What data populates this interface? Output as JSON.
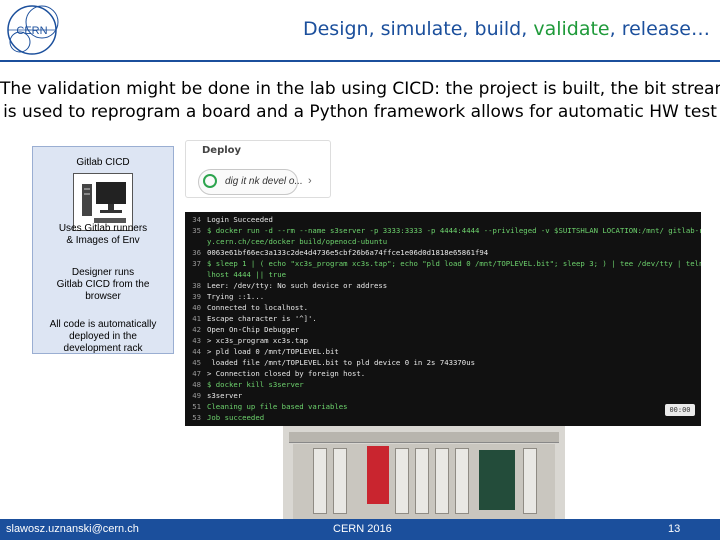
{
  "header": {
    "title_before": "Design, simulate, build, ",
    "title_highlight": "validate",
    "title_after": ", release…",
    "logo_text": "CERN"
  },
  "subtitle": {
    "line1": "The validation might be done in the lab using CICD: the project is built, the bit stream",
    "line2": "is used to reprogram a board and a Python framework allows for automatic HW test"
  },
  "info_box": {
    "heading": "Gitlab CICD",
    "runners": [
      "Uses Gitlab runners",
      "& Images of Env"
    ],
    "designer": [
      "Designer runs",
      "Gitlab CICD from the",
      "browser"
    ],
    "deployed": [
      "All code is automatically",
      "deployed in the",
      "development rack"
    ]
  },
  "deploy_card": {
    "label": "Deploy",
    "job_name": "dig it nk devel o...",
    "arrow": "›"
  },
  "terminal": {
    "lines": [
      {
        "n": "34",
        "t": "Login Succeeded",
        "green": false
      },
      {
        "n": "35",
        "t": "$ docker run -d --rm --name s3server -p 3333:3333 -p 4444:4444 --privileged -v $SUITSHLAN LOCATION:/mnt/ gitlab-registr",
        "green": true
      },
      {
        "n": "",
        "t": "y.cern.ch/cee/docker build/openocd-ubuntu",
        "green": true
      },
      {
        "n": "36",
        "t": "0063e61bf66ec3a133c2de4d4736e5cbf26b6a74ffce1e06d0d1818e65861f94",
        "green": false
      },
      {
        "n": "37",
        "t": "$ sleep 1 | ( echo \"xc3s_program xc3s.tap\"; echo \"pld load 0 /mnt/TOPLEVEL.bit\"; sleep 3; ) | tee /dev/tty | telnet loca",
        "green": true
      },
      {
        "n": "",
        "t": "lhost 4444 || true",
        "green": true
      },
      {
        "n": "38",
        "t": "Leer: /dev/tty: No such device or address",
        "green": false
      },
      {
        "n": "39",
        "t": "Trying ::1...",
        "green": false
      },
      {
        "n": "40",
        "t": "Connected to localhost.",
        "green": false
      },
      {
        "n": "41",
        "t": "Escape character is '^]'.",
        "green": false
      },
      {
        "n": "42",
        "t": "Open On-Chip Debugger",
        "green": false
      },
      {
        "n": "43",
        "t": "> xc3s_program xc3s.tap",
        "green": false
      },
      {
        "n": "44",
        "t": "> pld load 0 /mnt/TOPLEVEL.bit",
        "green": false
      },
      {
        "n": "45",
        "t": " loaded file /mnt/TOPLEVEL.bit to pld device 0 in 2s 743370us",
        "green": false
      },
      {
        "n": "47",
        "t": "> Connection closed by foreign host.",
        "green": false
      },
      {
        "n": "48",
        "t": "$ docker kill s3server",
        "green": true
      },
      {
        "n": "49",
        "t": "s3server",
        "green": false
      },
      {
        "n": "51",
        "t": "Cleaning up file based variables",
        "green": true
      },
      {
        "n": "53",
        "t": "Job succeeded",
        "green": true
      }
    ],
    "time_badge": "00:00"
  },
  "footer": {
    "email": "slawosz.uznanski@cern.ch",
    "event": "CERN 2016",
    "page": "13"
  },
  "colors": {
    "brand_blue": "#1b4f9c",
    "highlight_green": "#1f9a3a"
  }
}
